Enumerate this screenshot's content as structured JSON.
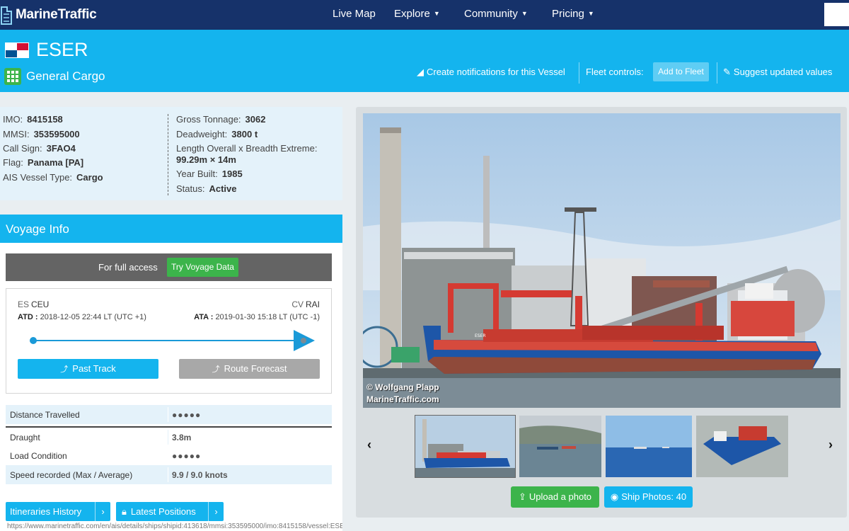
{
  "nav": {
    "logo": "MarineTraffic",
    "items": [
      {
        "label": "Live Map"
      },
      {
        "label": "Explore"
      },
      {
        "label": "Community"
      },
      {
        "label": "Pricing"
      }
    ]
  },
  "vessel": {
    "name": "ESER",
    "type": "General Cargo",
    "flag_colors": {
      "red": "#d21034",
      "blue": "#005293"
    }
  },
  "header_actions": {
    "notifications": "Create notifications for this Vessel",
    "fleet_controls": "Fleet controls:",
    "add_to_fleet": "Add to Fleet",
    "suggest": "Suggest updated values"
  },
  "particulars": {
    "imo_label": "IMO:",
    "imo": "8415158",
    "mmsi_label": "MMSI:",
    "mmsi": "353595000",
    "callsign_label": "Call Sign:",
    "callsign": "3FAO4",
    "flag_label": "Flag:",
    "flag": "Panama [PA]",
    "ais_type_label": "AIS Vessel Type:",
    "ais_type": "Cargo",
    "gross_label": "Gross Tonnage:",
    "gross": "3062",
    "dwt_label": "Deadweight:",
    "dwt": "3800 t",
    "loa_label": "Length Overall x Breadth Extreme:",
    "loa": "99.29m × 14m",
    "year_label": "Year Built:",
    "year": "1985",
    "status_label": "Status:",
    "status": "Active"
  },
  "voyage": {
    "title": "Voyage Info",
    "full_access": "For full access",
    "try_button": "Try Voyage Data",
    "origin_cc": "ES",
    "origin": "CEU",
    "dest_cc": "CV",
    "dest": "RAI",
    "atd_label": "ATD :",
    "atd": "2018-12-05 22:44 LT (UTC +1)",
    "ata_label": "ATA :",
    "ata": "2019-01-30 15:18 LT (UTC -1)",
    "past_track": "Past Track",
    "route_forecast": "Route Forecast",
    "stats": [
      {
        "label": "Distance Travelled",
        "value": "●●●●●"
      },
      {
        "label": "Draught",
        "value": "3.8m"
      },
      {
        "label": "Load Condition",
        "value": "●●●●●"
      },
      {
        "label": "Speed recorded (Max / Average)",
        "value": "9.9 / 9.0 knots"
      }
    ],
    "itineraries": "Itineraries History",
    "latest_positions": "Latest Positions",
    "status_url": "https://www.marinetraffic.com/en/ais/details/ships/shipid:413618/mmsi:353595000/imo:8415158/vessel:ESER"
  },
  "photos": {
    "credit_line1": "© Wolfgang Plapp",
    "credit_line2": "MarineTraffic.com",
    "upload": "Upload a photo",
    "ship_photos": "Ship Photos: 40"
  }
}
